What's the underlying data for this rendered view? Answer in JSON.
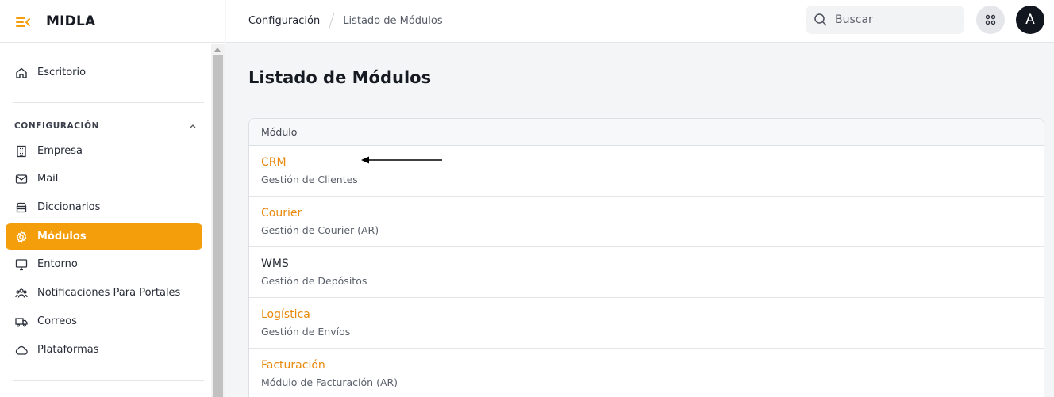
{
  "brand": {
    "name": "MIDLA",
    "accent": "#f59e0b"
  },
  "sidebar": {
    "top_item": {
      "label": "Escritorio",
      "icon": "home-icon"
    },
    "section": {
      "title": "CONFIGURACIÓN",
      "icon": "chevron-up-icon"
    },
    "items": [
      {
        "label": "Empresa",
        "icon": "building-icon",
        "active": false
      },
      {
        "label": "Mail",
        "icon": "mail-icon",
        "active": false
      },
      {
        "label": "Diccionarios",
        "icon": "archive-icon",
        "active": false
      },
      {
        "label": "Módulos",
        "icon": "gear-icon",
        "active": true
      },
      {
        "label": "Entorno",
        "icon": "monitor-icon",
        "active": false
      },
      {
        "label": "Notificaciones Para Portales",
        "icon": "users-icon",
        "active": false
      },
      {
        "label": "Correos",
        "icon": "truck-icon",
        "active": false
      },
      {
        "label": "Plataformas",
        "icon": "cloud-icon",
        "active": false
      }
    ]
  },
  "header": {
    "breadcrumb": [
      "Configuración",
      "Listado de Módulos"
    ],
    "search_placeholder": "Buscar",
    "avatar_initial": "A"
  },
  "main": {
    "title": "Listado de Módulos",
    "table": {
      "column": "Módulo",
      "rows": [
        {
          "name": "CRM",
          "description": "Gestión de Clientes",
          "link": true
        },
        {
          "name": "Courier",
          "description": "Gestión de Courier (AR)",
          "link": true
        },
        {
          "name": "WMS",
          "description": "Gestión de Depósitos",
          "link": false
        },
        {
          "name": "Logística",
          "description": "Gestión de Envíos",
          "link": true
        },
        {
          "name": "Facturación",
          "description": "Módulo de Facturación (AR)",
          "link": true
        }
      ]
    }
  }
}
